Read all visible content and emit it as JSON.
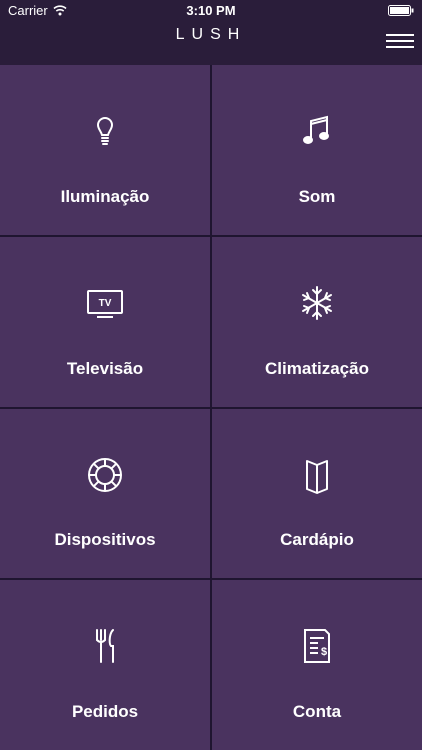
{
  "status": {
    "carrier": "Carrier",
    "time": "3:10 PM"
  },
  "nav": {
    "logo": "LUSH"
  },
  "tiles": [
    {
      "label": "Iluminação",
      "icon": "lightbulb-icon"
    },
    {
      "label": "Som",
      "icon": "music-note-icon"
    },
    {
      "label": "Televisão",
      "icon": "tv-icon",
      "icon_text": "TV"
    },
    {
      "label": "Climatização",
      "icon": "snowflake-icon"
    },
    {
      "label": "Dispositivos",
      "icon": "dial-icon"
    },
    {
      "label": "Cardápio",
      "icon": "menu-book-icon"
    },
    {
      "label": "Pedidos",
      "icon": "fork-knife-icon"
    },
    {
      "label": "Conta",
      "icon": "bill-icon"
    }
  ]
}
